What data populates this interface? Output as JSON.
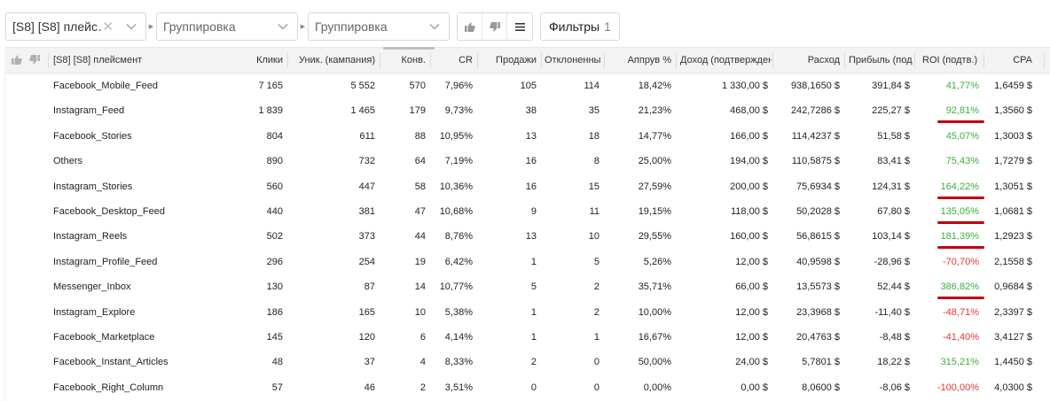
{
  "toolbar": {
    "group1": {
      "value": "[S8] [S8] плейс…",
      "clear_icon": "close-icon"
    },
    "group2": {
      "placeholder": "Группировка"
    },
    "group3": {
      "placeholder": "Группировка"
    },
    "filters": {
      "label": "Фильтры",
      "count": "1"
    }
  },
  "colors": {
    "positive": "#3fae3f",
    "negative": "#e8362d",
    "underline": "#c0000d"
  },
  "table": {
    "columns": {
      "placement": "[S8] [S8] плейсмент",
      "clicks": "Клики",
      "unique": "Уник. (кампания)",
      "conv": "Конв.",
      "cr": "CR",
      "sales": "Продажи",
      "rejected": "Отклоненны",
      "approve": "Аппрув %",
      "revenue": "Доход (подтвержден",
      "cost": "Расход",
      "profit": "Прибыль (под",
      "roi": "ROI (подтв.)",
      "cpa": "CPA"
    },
    "rows": [
      {
        "placement": "Facebook_Mobile_Feed",
        "clicks": "7 165",
        "unique": "5 552",
        "conv": "570",
        "cr": "7,96%",
        "sales": "105",
        "rejected": "114",
        "approve": "18,42%",
        "revenue": "1 330,00 $",
        "cost": "938,1650 $",
        "profit": "391,84 $",
        "roi": "41,77%",
        "roi_sign": "positive",
        "highlighted": false,
        "cpa": "1,6459 $"
      },
      {
        "placement": "Instagram_Feed",
        "clicks": "1 839",
        "unique": "1 465",
        "conv": "179",
        "cr": "9,73%",
        "sales": "38",
        "rejected": "35",
        "approve": "21,23%",
        "revenue": "468,00 $",
        "cost": "242,7286 $",
        "profit": "225,27 $",
        "roi": "92,81%",
        "roi_sign": "positive",
        "highlighted": true,
        "cpa": "1,3560 $"
      },
      {
        "placement": "Facebook_Stories",
        "clicks": "804",
        "unique": "611",
        "conv": "88",
        "cr": "10,95%",
        "sales": "13",
        "rejected": "18",
        "approve": "14,77%",
        "revenue": "166,00 $",
        "cost": "114,4237 $",
        "profit": "51,58 $",
        "roi": "45,07%",
        "roi_sign": "positive",
        "highlighted": false,
        "cpa": "1,3003 $"
      },
      {
        "placement": "Others",
        "clicks": "890",
        "unique": "732",
        "conv": "64",
        "cr": "7,19%",
        "sales": "16",
        "rejected": "8",
        "approve": "25,00%",
        "revenue": "194,00 $",
        "cost": "110,5875 $",
        "profit": "83,41 $",
        "roi": "75,43%",
        "roi_sign": "positive",
        "highlighted": false,
        "cpa": "1,7279 $"
      },
      {
        "placement": "Instagram_Stories",
        "clicks": "560",
        "unique": "447",
        "conv": "58",
        "cr": "10,36%",
        "sales": "16",
        "rejected": "15",
        "approve": "27,59%",
        "revenue": "200,00 $",
        "cost": "75,6934 $",
        "profit": "124,31 $",
        "roi": "164,22%",
        "roi_sign": "positive",
        "highlighted": true,
        "cpa": "1,3051 $"
      },
      {
        "placement": "Facebook_Desktop_Feed",
        "clicks": "440",
        "unique": "381",
        "conv": "47",
        "cr": "10,68%",
        "sales": "9",
        "rejected": "11",
        "approve": "19,15%",
        "revenue": "118,00 $",
        "cost": "50,2028 $",
        "profit": "67,80 $",
        "roi": "135,05%",
        "roi_sign": "positive",
        "highlighted": true,
        "cpa": "1,0681 $"
      },
      {
        "placement": "Instagram_Reels",
        "clicks": "502",
        "unique": "373",
        "conv": "44",
        "cr": "8,76%",
        "sales": "13",
        "rejected": "10",
        "approve": "29,55%",
        "revenue": "160,00 $",
        "cost": "56,8615 $",
        "profit": "103,14 $",
        "roi": "181,39%",
        "roi_sign": "positive",
        "highlighted": true,
        "cpa": "1,2923 $"
      },
      {
        "placement": "Instagram_Profile_Feed",
        "clicks": "296",
        "unique": "254",
        "conv": "19",
        "cr": "6,42%",
        "sales": "1",
        "rejected": "5",
        "approve": "5,26%",
        "revenue": "12,00 $",
        "cost": "40,9598 $",
        "profit": "-28,96 $",
        "roi": "-70,70%",
        "roi_sign": "negative",
        "highlighted": false,
        "cpa": "2,1558 $"
      },
      {
        "placement": "Messenger_Inbox",
        "clicks": "130",
        "unique": "87",
        "conv": "14",
        "cr": "10,77%",
        "sales": "5",
        "rejected": "2",
        "approve": "35,71%",
        "revenue": "66,00 $",
        "cost": "13,5573 $",
        "profit": "52,44 $",
        "roi": "386,82%",
        "roi_sign": "positive",
        "highlighted": true,
        "cpa": "0,9684 $"
      },
      {
        "placement": "Instagram_Explore",
        "clicks": "186",
        "unique": "165",
        "conv": "10",
        "cr": "5,38%",
        "sales": "1",
        "rejected": "2",
        "approve": "10,00%",
        "revenue": "12,00 $",
        "cost": "23,3968 $",
        "profit": "-11,40 $",
        "roi": "-48,71%",
        "roi_sign": "negative",
        "highlighted": false,
        "cpa": "2,3397 $"
      },
      {
        "placement": "Facebook_Marketplace",
        "clicks": "145",
        "unique": "120",
        "conv": "6",
        "cr": "4,14%",
        "sales": "1",
        "rejected": "1",
        "approve": "16,67%",
        "revenue": "12,00 $",
        "cost": "20,4763 $",
        "profit": "-8,48 $",
        "roi": "-41,40%",
        "roi_sign": "negative",
        "highlighted": false,
        "cpa": "3,4127 $"
      },
      {
        "placement": "Facebook_Instant_Articles",
        "clicks": "48",
        "unique": "37",
        "conv": "4",
        "cr": "8,33%",
        "sales": "2",
        "rejected": "0",
        "approve": "50,00%",
        "revenue": "24,00 $",
        "cost": "5,7801 $",
        "profit": "18,22 $",
        "roi": "315,21%",
        "roi_sign": "positive",
        "highlighted": false,
        "cpa": "1,4450 $"
      },
      {
        "placement": "Facebook_Right_Column",
        "clicks": "57",
        "unique": "46",
        "conv": "2",
        "cr": "3,51%",
        "sales": "0",
        "rejected": "0",
        "approve": "0,00%",
        "revenue": "0,00 $",
        "cost": "8,0600 $",
        "profit": "-8,06 $",
        "roi": "-100,00%",
        "roi_sign": "negative",
        "highlighted": false,
        "cpa": "4,0300 $"
      }
    ]
  }
}
